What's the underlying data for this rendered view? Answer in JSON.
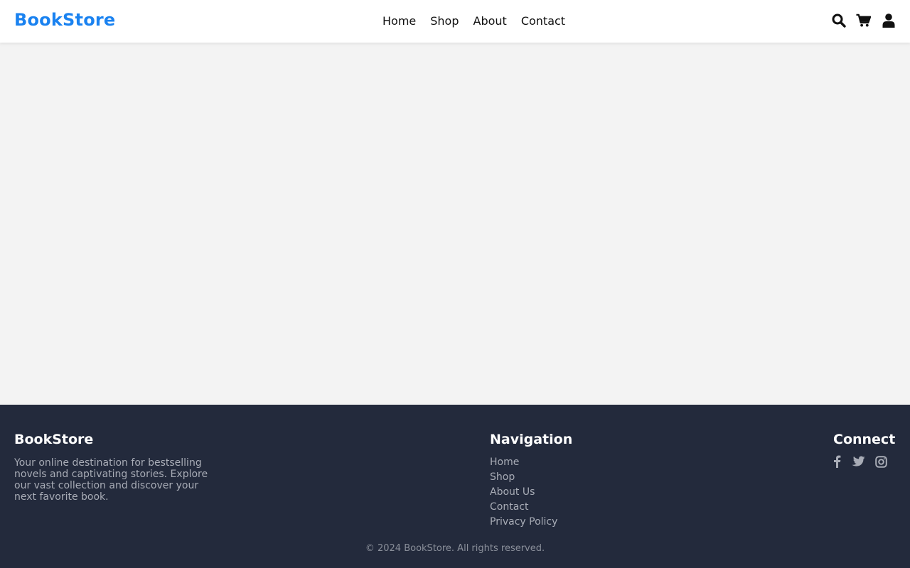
{
  "header": {
    "logo": "BookStore",
    "nav": [
      {
        "label": "Home"
      },
      {
        "label": "Shop"
      },
      {
        "label": "About"
      },
      {
        "label": "Contact"
      }
    ],
    "icons": [
      "search-icon",
      "cart-icon",
      "user-icon"
    ]
  },
  "footer": {
    "brand": "BookStore",
    "description": "Your online destination for bestselling novels and captivating stories. Explore our vast collection and discover your next favorite book.",
    "navigation_title": "Navigation",
    "links": [
      {
        "label": "Home"
      },
      {
        "label": "Shop"
      },
      {
        "label": "About Us"
      },
      {
        "label": "Contact"
      },
      {
        "label": "Privacy Policy"
      }
    ],
    "connect_title": "Connect",
    "socials": [
      "facebook-icon",
      "twitter-icon",
      "instagram-icon"
    ],
    "copyright": "© 2024 BookStore. All rights reserved."
  },
  "colors": {
    "brand": "#1a82f0",
    "header_bg": "#ffffff",
    "page_bg": "#f3f3f3",
    "footer_bg": "#232a3c",
    "footer_text_muted": "#a8acb6"
  }
}
